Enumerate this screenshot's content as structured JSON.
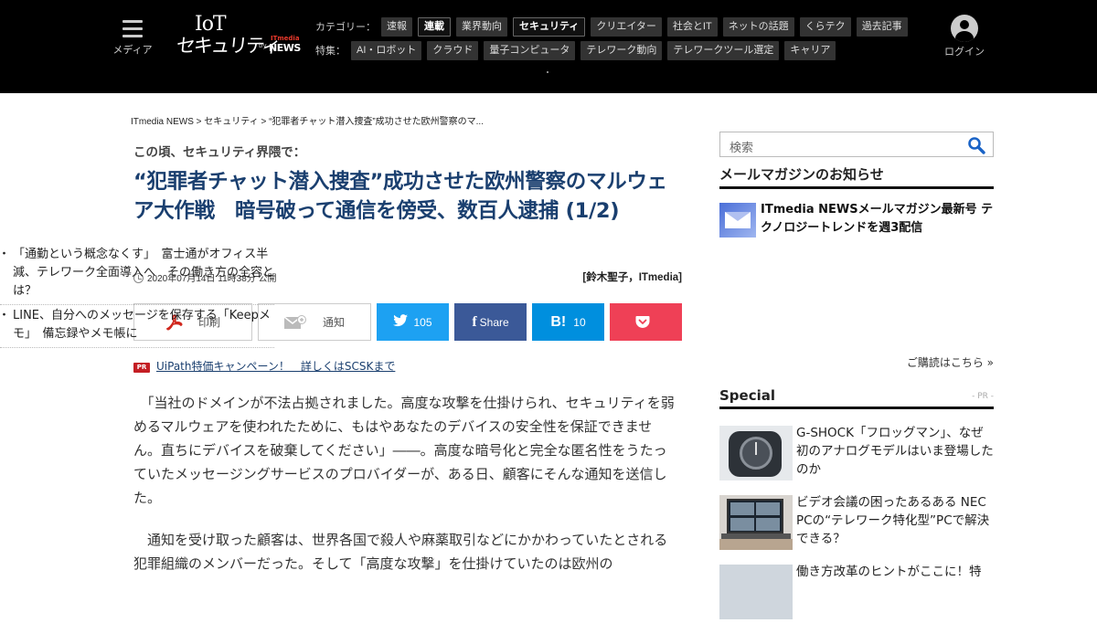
{
  "header": {
    "menu_label": "メディア",
    "logo": {
      "iot": "IoT",
      "security": "セキュリティ",
      "by": "by",
      "itmedia": "ITmedia",
      "news": "NEWS"
    },
    "category_caption": "カテゴリー：",
    "categories": [
      "速報",
      "連載",
      "業界動向",
      "セキュリティ",
      "クリエイター",
      "社会とIT",
      "ネットの話題",
      "くらテク",
      "過去記事"
    ],
    "highlighted_categories": [
      "連載",
      "セキュリティ"
    ],
    "feature_caption": "特集：",
    "features": [
      "AI・ロボット",
      "クラウド",
      "量子コンピュータ",
      "テレワーク動向",
      "テレワークツール選定",
      "キャリア"
    ],
    "login_label": "ログイン"
  },
  "breadcrumb": "ITmedia NEWS > セキュリティ > “犯罪者チャット潜入捜査”成功させた欧州警察のマ...",
  "article": {
    "kicker": "この頃、セキュリティ界隈で：",
    "title": "“犯罪者チャット潜入捜査”成功させた欧州警察のマルウェア大作戦　暗号破って通信を傍受、数百人逮捕 (1/2)",
    "date": "2020年07月14日 11時38分 公開",
    "author": "[鈴木聖子，ITmedia]",
    "share": {
      "print_label": "印刷",
      "notify_label": "通知",
      "twitter_count": "105",
      "facebook_label": "Share",
      "hatena_label": "B!",
      "hatena_count": "10"
    },
    "pr_badge": "PR",
    "pr_text": "UiPath特価キャンペーン！　詳しくはSCSKまで",
    "paragraphs": [
      "　「当社のドメインが不法占拠されました。高度な攻撃を仕掛けられ、セキュリティを弱めるマルウェアを使われたために、もはやあなたのデバイスの安全性を保証できません。直ちにデバイスを破棄してください」――。高度な暗号化と完全な匿名性をうたっていたメッセージングサービスのプロバイダーが、ある日、顧客にそんな通知を送信した。",
      "　通知を受け取った顧客は、世界各国で殺人や麻薬取引などにかかわっていたとされる犯罪組織のメンバーだった。そして「高度な攻撃」を仕掛けていたのは欧州の"
    ]
  },
  "sidebar": {
    "search_placeholder": "検索",
    "mailmag": {
      "heading": "メールマガジンのお知らせ",
      "featured": "ITmedia NEWSメールマガジン最新号 テクノロジートレンドを週3配信",
      "items": [
        "「通勤という概念なくす」　富士通がオフィス半減、テレワーク全面導入へ　その働き方の全容とは？",
        "LINE、自分へのメッセージを保存する「Keepメモ」　備忘録やメモ帳に"
      ],
      "subscribe": "ご購読はこちら »"
    },
    "special": {
      "heading": "Special",
      "pr_note": "- PR -",
      "items": [
        "G-SHOCK「フロッグマン」、なぜ初のアナログモデルはいま登場したのか",
        "ビデオ会議の困ったあるある NEC PCの“テレワーク特化型”PCで解決できる？",
        "働き方改革のヒントがここに！特"
      ]
    }
  },
  "colors": {
    "header_bg": "#000000",
    "title": "#1a3f6f",
    "twitter": "#1da1f2",
    "facebook": "#3b5998",
    "hatena": "#008fde",
    "pocket": "#ef4056",
    "pr_badge": "#c41e24"
  },
  "icons": [
    "menu-icon",
    "user-avatar-icon",
    "clock-icon",
    "pdf-icon",
    "mail-add-icon",
    "twitter-icon",
    "facebook-icon",
    "hatena-icon",
    "pocket-icon",
    "search-icon",
    "envelope-icon"
  ]
}
